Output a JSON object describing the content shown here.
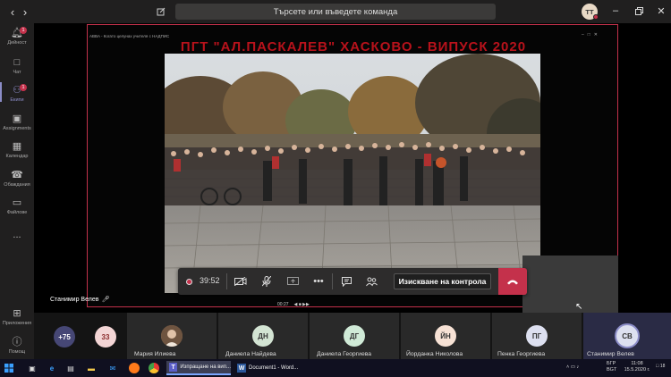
{
  "topbar": {
    "search_placeholder": "Търсете или въведете команда",
    "user_initials": "ТТ"
  },
  "rail": {
    "items": [
      {
        "label": "Дейност",
        "badge": "1"
      },
      {
        "label": "Чат",
        "badge": ""
      },
      {
        "label": "Екипи",
        "badge": "1"
      },
      {
        "label": "Assignments",
        "badge": ""
      },
      {
        "label": "Календар",
        "badge": ""
      },
      {
        "label": "Обаждания",
        "badge": ""
      },
      {
        "label": "Файлове",
        "badge": ""
      },
      {
        "label": "...",
        "badge": ""
      },
      {
        "label": "Приложения",
        "badge": ""
      },
      {
        "label": "Помощ",
        "badge": ""
      }
    ]
  },
  "stage": {
    "shared_window_title": "ABBA - Когато целунах учителя с НАДПИС",
    "video_title": "ПГТ \"АЛ.ПАСКАЛЕВ\" ХАСКОВО - ВИПУСК 2020",
    "player_time": "00:27",
    "presenter_name": "Станимир Велев"
  },
  "controls": {
    "timer": "39:52",
    "request_control_label": "Изискване на контрола"
  },
  "participants": {
    "overflow_count": "+75",
    "count_2": "33",
    "people": [
      {
        "name": "Мария Илиева",
        "initials": ""
      },
      {
        "name": "Даниела Найдева",
        "initials": "ДН"
      },
      {
        "name": "Даниела Георгиева",
        "initials": "ДГ"
      },
      {
        "name": "Йорданка Николова",
        "initials": "ЙН"
      },
      {
        "name": "Пенка Георгиева",
        "initials": "ПГ"
      },
      {
        "name": "Станимир Велев",
        "initials": "СВ"
      }
    ]
  },
  "taskbar": {
    "task_teams": "Изпращане на вип...",
    "task_word": "Document1 - Word...",
    "lang": "БГР",
    "lang2": "BGT",
    "time": "11:08",
    "date": "15.5.2020 г.",
    "notifications": "18"
  },
  "colors": {
    "accent": "#8b8cc7",
    "hangup": "#c4314b",
    "title_red": "#b8121b"
  }
}
